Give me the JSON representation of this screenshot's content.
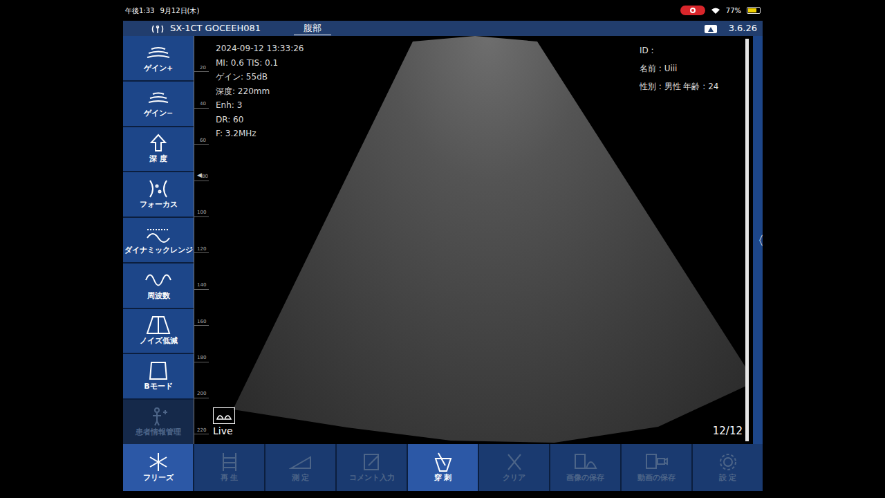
{
  "status_bar": {
    "time": "午後1:33",
    "date": "9月12日(木)",
    "battery": "77%",
    "recording": true,
    "battery_level": 0.77
  },
  "header": {
    "device": "SX-1CT GOCEEH081",
    "mode": "腹部",
    "version": "3.6.26"
  },
  "sidebar": {
    "items": [
      {
        "label": "ゲイン+",
        "disabled": false
      },
      {
        "label": "ゲイン−",
        "disabled": false
      },
      {
        "label": "深 度",
        "disabled": false
      },
      {
        "label": "フォーカス",
        "disabled": false
      },
      {
        "label": "ダイナミックレンジ",
        "disabled": false
      },
      {
        "label": "周波数",
        "disabled": false
      },
      {
        "label": "ノイズ低減",
        "disabled": false
      },
      {
        "label": "Bモード",
        "disabled": false
      },
      {
        "label": "患者情報管理",
        "disabled": true
      }
    ]
  },
  "ruler": {
    "focus_glyph": "◀",
    "ticks": [
      {
        "label": "20",
        "focus": false
      },
      {
        "label": "40",
        "focus": false
      },
      {
        "label": "60",
        "focus": false
      },
      {
        "label": "80",
        "focus": true
      },
      {
        "label": "100",
        "focus": false
      },
      {
        "label": "120",
        "focus": false
      },
      {
        "label": "140",
        "focus": false
      },
      {
        "label": "160",
        "focus": false
      },
      {
        "label": "180",
        "focus": false
      },
      {
        "label": "200",
        "focus": false
      },
      {
        "label": "220",
        "focus": false
      }
    ]
  },
  "image_info": [
    "2024-09-12 13:33:26",
    "MI: 0.6  TIS: 0.1",
    "ゲイン: 55dB",
    "深度: 220mm",
    "Enh: 3",
    "DR: 60",
    "F: 3.2MHz"
  ],
  "patient": [
    "ID :",
    "名前 :  Uiii",
    "性別 :  男性      年齢 :  24"
  ],
  "live_label": "Live",
  "frame_counter": "12/12",
  "side_tab": "〈",
  "bottom_bar": {
    "items": [
      {
        "label": "フリーズ",
        "selected": true,
        "disabled": false
      },
      {
        "label": "再 生",
        "selected": false,
        "disabled": true
      },
      {
        "label": "測 定",
        "selected": false,
        "disabled": true
      },
      {
        "label": "コメント入力",
        "selected": false,
        "disabled": true
      },
      {
        "label": "穿 刺",
        "selected": true,
        "disabled": false
      },
      {
        "label": "クリア",
        "selected": false,
        "disabled": true
      },
      {
        "label": "画像の保存",
        "selected": false,
        "disabled": true
      },
      {
        "label": "動画の保存",
        "selected": false,
        "disabled": true
      },
      {
        "label": "設 定",
        "selected": false,
        "disabled": true
      }
    ]
  }
}
